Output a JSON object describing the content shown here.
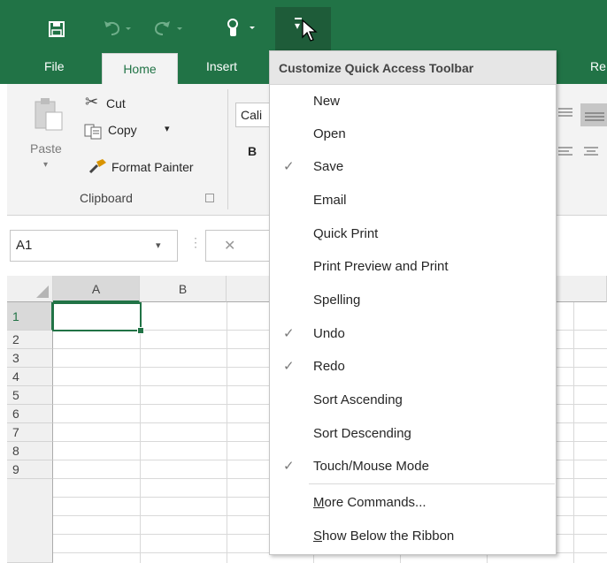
{
  "qat": {
    "active_dropdown_glyph": "▾",
    "icons": [
      "save-icon",
      "undo-icon",
      "redo-icon",
      "touch-mode-icon",
      "customize-qat-icon",
      "mouse-pointer-icon"
    ]
  },
  "tabs": {
    "file": "File",
    "home": "Home",
    "insert": "Insert",
    "review_partial": "Re"
  },
  "ribbon": {
    "paste": "Paste",
    "cut": "Cut",
    "copy": "Copy",
    "format_painter": "Format Painter",
    "clipboard_group": "Clipboard",
    "font_partial": "Cali",
    "bold": "B"
  },
  "formula_bar": {
    "name_box": "A1",
    "cancel_glyph": "✕"
  },
  "grid": {
    "columns": [
      "A",
      "B"
    ],
    "rows": [
      "1",
      "2",
      "3",
      "4",
      "5",
      "6",
      "7",
      "8",
      "9"
    ]
  },
  "menu": {
    "title": "Customize Quick Access Toolbar",
    "items": [
      {
        "label": "New",
        "checked": false
      },
      {
        "label": "Open",
        "checked": false
      },
      {
        "label": "Save",
        "checked": true
      },
      {
        "label": "Email",
        "checked": false
      },
      {
        "label": "Quick Print",
        "checked": false
      },
      {
        "label": "Print Preview and Print",
        "checked": false
      },
      {
        "label": "Spelling",
        "checked": false
      },
      {
        "label": "Undo",
        "checked": true
      },
      {
        "label": "Redo",
        "checked": true
      },
      {
        "label": "Sort Ascending",
        "checked": false
      },
      {
        "label": "Sort Descending",
        "checked": false
      },
      {
        "label": "Touch/Mouse Mode",
        "checked": true
      }
    ],
    "more_commands_accel": "M",
    "more_commands_rest": "ore Commands...",
    "show_below_accel": "S",
    "show_below_rest": "how Below the Ribbon",
    "check_glyph": "✓"
  },
  "colors": {
    "excel_green": "#217346",
    "ribbon_bg": "#f3f3f3",
    "selection_border": "#217346"
  }
}
